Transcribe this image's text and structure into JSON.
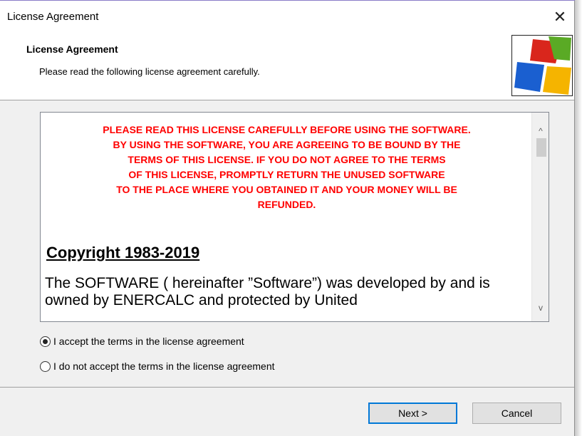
{
  "window": {
    "title": "License Agreement",
    "close_glyph": "✕"
  },
  "header": {
    "title": "License Agreement",
    "subtitle": "Please read the following license agreement carefully.",
    "logo_icon": "installer-logo-icon",
    "logo_colors": [
      "#d9261c",
      "#5aaa25",
      "#1a5fd0",
      "#f5b400"
    ]
  },
  "license": {
    "warning_lines": [
      "PLEASE READ THIS LICENSE CAREFULLY BEFORE USING THE SOFTWARE.",
      "BY USING THE SOFTWARE, YOU ARE AGREEING TO BE BOUND BY THE",
      "TERMS OF THIS LICENSE. IF YOU DO NOT AGREE TO THE TERMS",
      "OF THIS LICENSE, PROMPTLY RETURN THE UNUSED SOFTWARE",
      "TO THE PLACE WHERE YOU OBTAINED IT AND YOUR MONEY WILL BE",
      "REFUNDED."
    ],
    "copyright": "Copyright 1983-2019",
    "paragraph": "The SOFTWARE ( hereinafter ”Software”) was developed by and is owned by ENERCALC and protected by United",
    "warning_color": "#ff0000",
    "scroll_up_glyph": "^",
    "scroll_down_glyph": "v"
  },
  "options": {
    "accept_label": "I accept the terms in the license agreement",
    "decline_label": "I do not accept the terms in the license agreement",
    "selected": "accept"
  },
  "buttons": {
    "next_label": "Next >",
    "cancel_label": "Cancel"
  },
  "accent_color": "#0078d7"
}
